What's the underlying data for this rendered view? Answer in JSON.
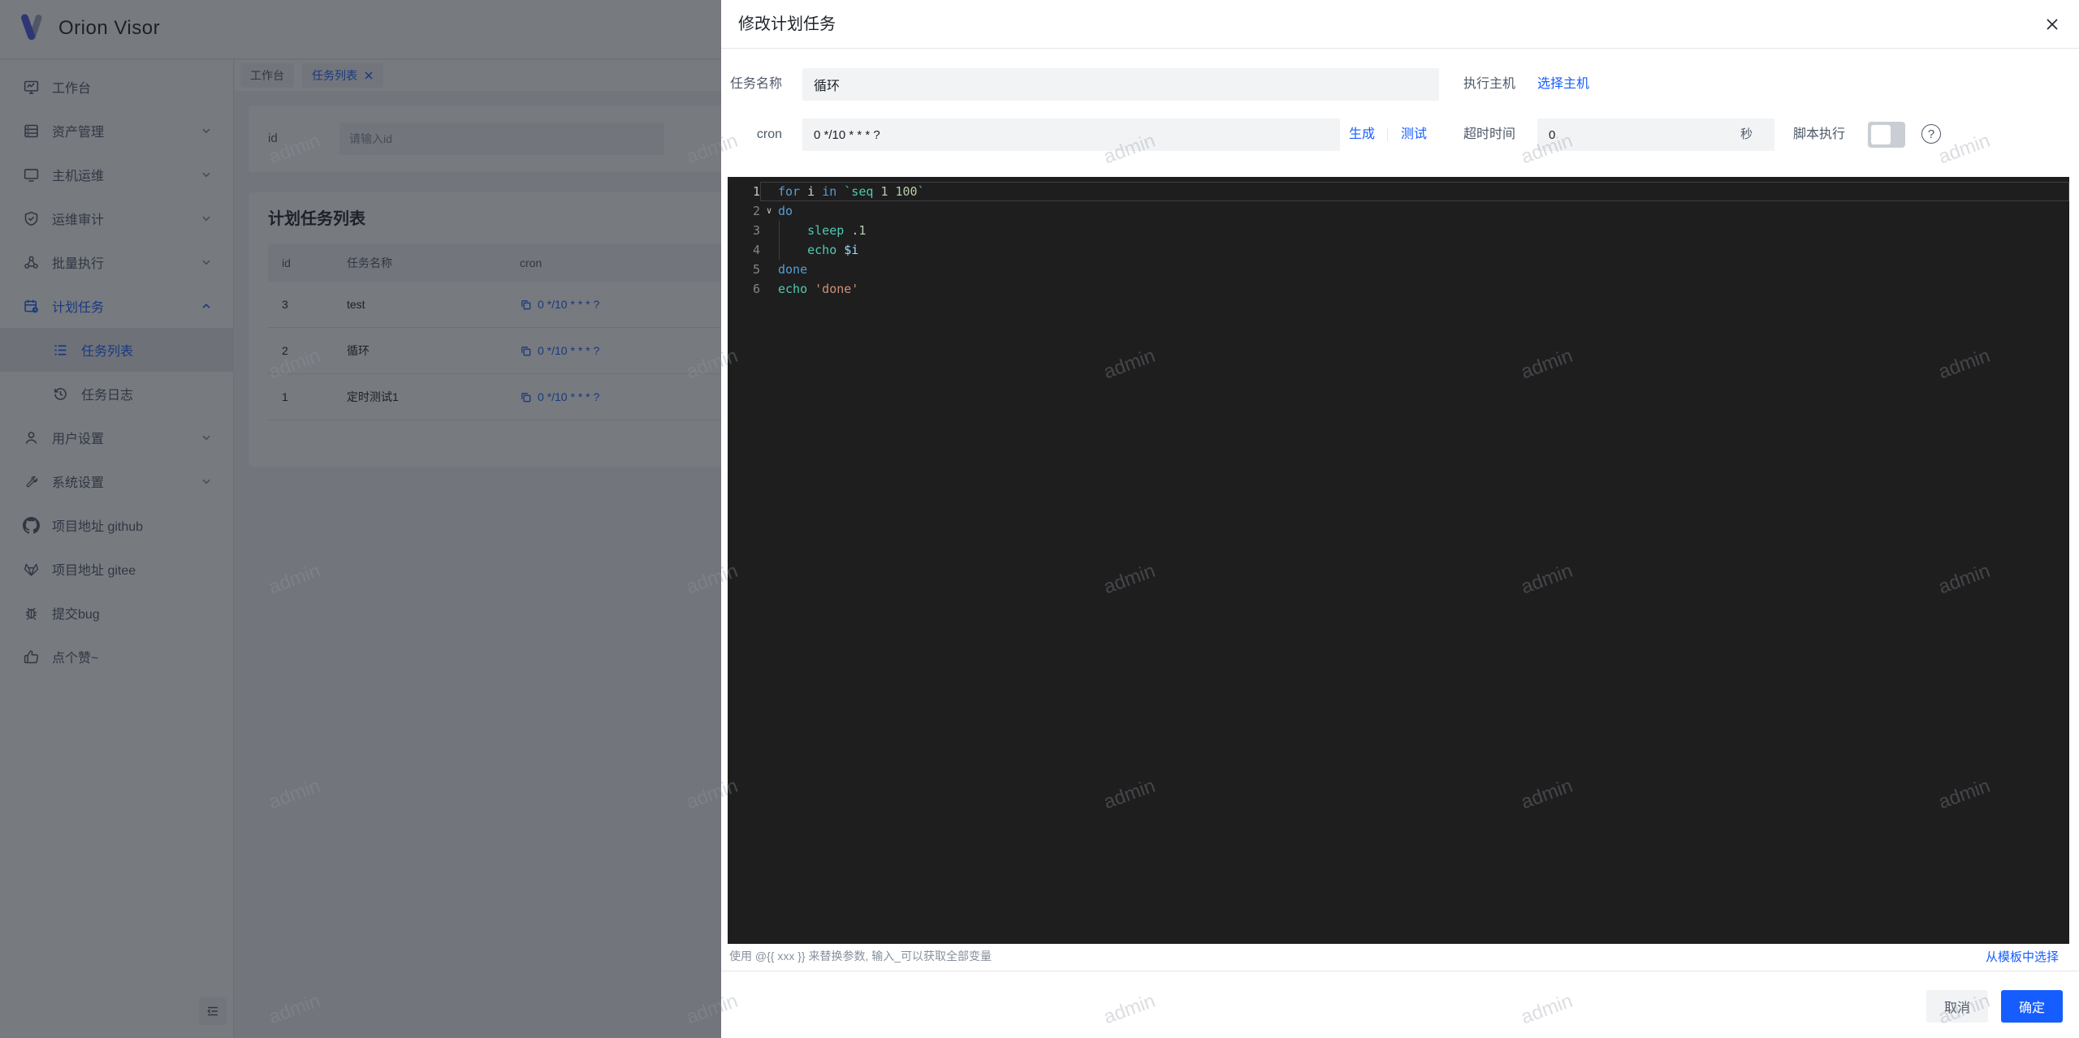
{
  "app": {
    "title": "Orion Visor",
    "watermark": "admin"
  },
  "colors": {
    "accent": "#165dff",
    "mask": "rgba(29,33,41,0.6)",
    "editor_bg": "#1e1e1e"
  },
  "sidebar": {
    "items": [
      {
        "label": "工作台"
      },
      {
        "label": "资产管理"
      },
      {
        "label": "主机运维"
      },
      {
        "label": "运维审计"
      },
      {
        "label": "批量执行"
      },
      {
        "label": "计划任务"
      },
      {
        "label": "任务列表"
      },
      {
        "label": "任务日志"
      },
      {
        "label": "用户设置"
      },
      {
        "label": "系统设置"
      },
      {
        "label": "项目地址 github"
      },
      {
        "label": "项目地址 gitee"
      },
      {
        "label": "提交bug"
      },
      {
        "label": "点个赞~"
      }
    ]
  },
  "tabs": [
    {
      "label": "工作台"
    },
    {
      "label": "任务列表"
    }
  ],
  "filter": {
    "id_label": "id",
    "id_placeholder": "请输入id",
    "id_value": ""
  },
  "list": {
    "title": "计划任务列表",
    "columns": [
      "id",
      "任务名称",
      "cron"
    ],
    "rows": [
      {
        "id": "3",
        "name": "test",
        "cron": "0 */10 * * * ?"
      },
      {
        "id": "2",
        "name": "循环",
        "cron": "0 */10 * * * ?"
      },
      {
        "id": "1",
        "name": "定时测试1",
        "cron": "0 */10 * * * ?"
      }
    ]
  },
  "modal": {
    "title": "修改计划任务",
    "fields": {
      "name_label": "任务名称",
      "name_value": "循环",
      "host_label": "执行主机",
      "host_link": "选择主机",
      "cron_label": "cron",
      "cron_value": "0 */10 * * * ?",
      "generate_link": "生成",
      "test_link": "测试",
      "timeout_label": "超时时间",
      "timeout_value": "0",
      "timeout_unit": "秒",
      "script_label": "脚本执行",
      "script_switch_on": false
    },
    "editor": {
      "lines": [
        {
          "num": "1",
          "active": true,
          "fold": false,
          "tokens": [
            [
              "for",
              "kw"
            ],
            [
              " i ",
              "fg"
            ],
            [
              "in",
              "kw"
            ],
            [
              " ",
              "fg"
            ],
            [
              "`seq",
              "cmd"
            ],
            [
              " ",
              "fg"
            ],
            [
              "1 100",
              "num"
            ],
            [
              "`",
              "cmd"
            ]
          ]
        },
        {
          "num": "2",
          "active": false,
          "fold": true,
          "tokens": [
            [
              "do",
              "kw"
            ]
          ]
        },
        {
          "num": "3",
          "active": false,
          "fold": false,
          "tokens": [
            [
              "    ",
              "fg"
            ],
            [
              "sleep",
              "cmd"
            ],
            [
              " ",
              "fg"
            ],
            [
              ".1",
              "num"
            ]
          ]
        },
        {
          "num": "4",
          "active": false,
          "fold": false,
          "tokens": [
            [
              "    ",
              "fg"
            ],
            [
              "echo",
              "cmd"
            ],
            [
              " ",
              "fg"
            ],
            [
              "$i",
              "var"
            ]
          ]
        },
        {
          "num": "5",
          "active": false,
          "fold": false,
          "tokens": [
            [
              "done",
              "kw"
            ]
          ]
        },
        {
          "num": "6",
          "active": false,
          "fold": false,
          "tokens": [
            [
              "echo",
              "cmd"
            ],
            [
              " ",
              "fg"
            ],
            [
              "'done'",
              "str"
            ]
          ]
        }
      ]
    },
    "hint": "使用 @{{ xxx }} 来替换参数, 输入_可以获取全部变量",
    "template_link": "从模板中选择",
    "footer": {
      "cancel": "取消",
      "ok": "确定"
    }
  }
}
